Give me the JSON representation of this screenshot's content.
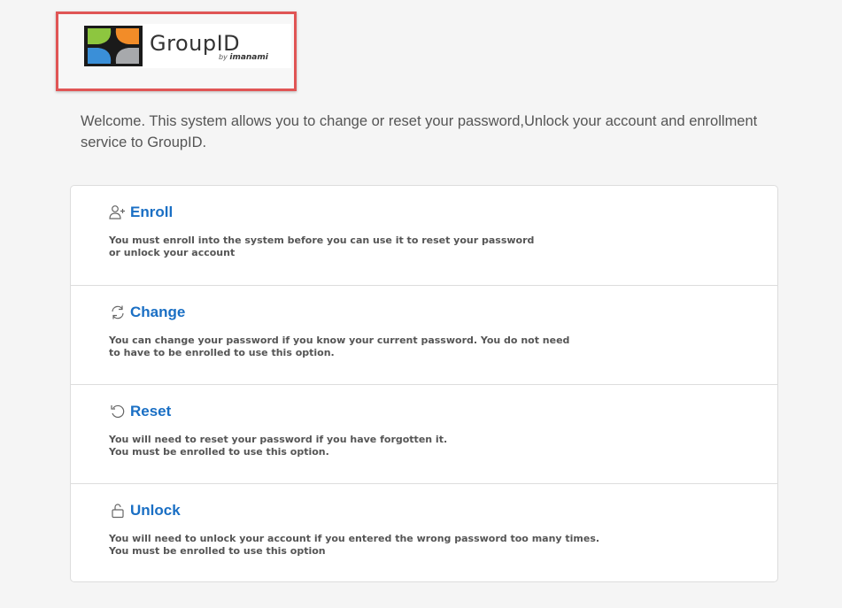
{
  "logo": {
    "word": "GroupID",
    "by": "by",
    "brand": "imanami"
  },
  "welcome_text": "Welcome. This system allows you to change or reset your password,Unlock your account and enrollment service to GroupID.",
  "colors": {
    "link": "#1a6fc4",
    "text": "#555555",
    "highlight_border": "#e05555"
  },
  "options": [
    {
      "icon": "user-plus-icon",
      "title": "Enroll",
      "desc_line1": "You must enroll into the system before you can use it to reset your password",
      "desc_line2": "or unlock your account"
    },
    {
      "icon": "refresh-icon",
      "title": "Change",
      "desc_line1": "You can change your password if you know your current password. You do not need",
      "desc_line2": "to have to be enrolled to use this option."
    },
    {
      "icon": "undo-icon",
      "title": "Reset",
      "desc_line1": "You will need to reset your password if you have forgotten it.",
      "desc_line2": "You must be enrolled to use this option."
    },
    {
      "icon": "unlock-icon",
      "title": "Unlock",
      "desc_line1": "You will need to unlock your account if you entered the wrong password too many times.",
      "desc_line2": "You must be enrolled to use this option"
    }
  ]
}
